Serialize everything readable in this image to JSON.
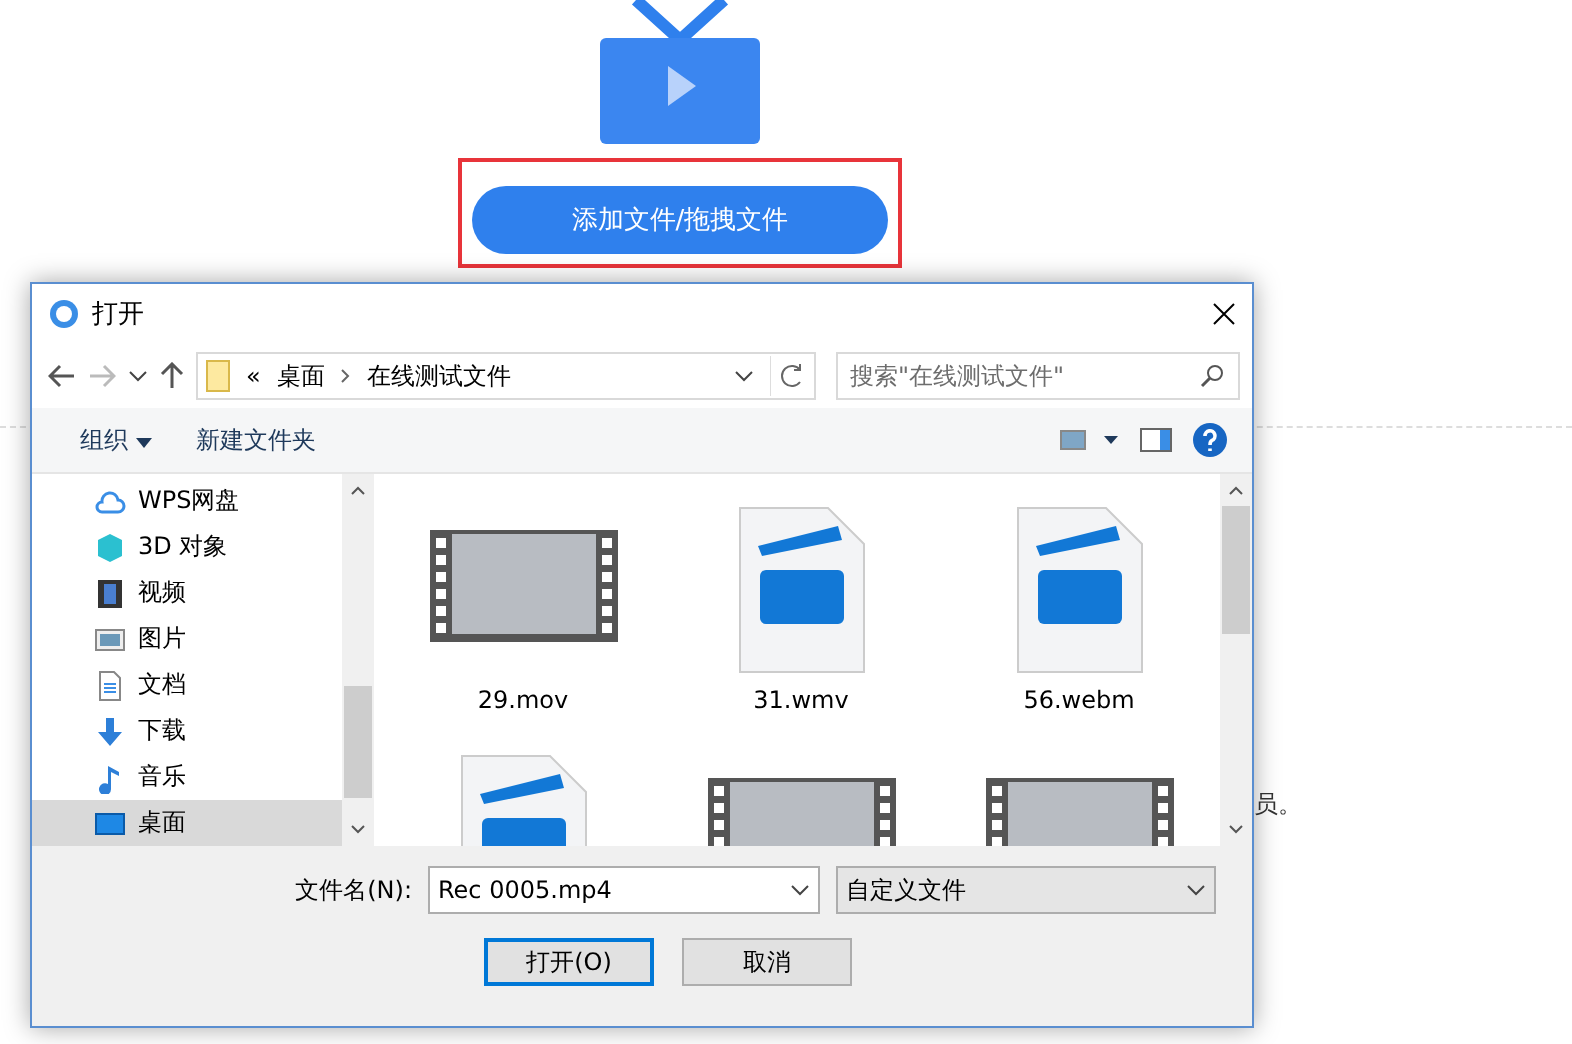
{
  "page": {
    "upload_button": "添加文件/拖拽文件",
    "trailing_text": "员。"
  },
  "dialog": {
    "title": "打开",
    "breadcrumb": {
      "prefix": "«",
      "parts": [
        "桌面",
        "在线测试文件"
      ]
    },
    "search": {
      "placeholder": "搜索\"在线测试文件\""
    },
    "toolbar": {
      "organize": "组织",
      "new_folder": "新建文件夹"
    },
    "sidebar": [
      {
        "kind": "cloud",
        "label": "WPS网盘",
        "selected": false
      },
      {
        "kind": "cube",
        "label": "3D 对象",
        "selected": false
      },
      {
        "kind": "film",
        "label": "视频",
        "selected": false
      },
      {
        "kind": "picture",
        "label": "图片",
        "selected": false
      },
      {
        "kind": "doc",
        "label": "文档",
        "selected": false
      },
      {
        "kind": "download",
        "label": "下载",
        "selected": false
      },
      {
        "kind": "music",
        "label": "音乐",
        "selected": false
      },
      {
        "kind": "desktop",
        "label": "桌面",
        "selected": true
      }
    ],
    "files": [
      {
        "kind": "video",
        "name": "29.mov"
      },
      {
        "kind": "clip",
        "name": "31.wmv"
      },
      {
        "kind": "clip",
        "name": "56.webm"
      },
      {
        "kind": "clip"
      },
      {
        "kind": "video"
      },
      {
        "kind": "video"
      }
    ],
    "filename_label": "文件名(N):",
    "filename": "Rec 0005.mp4",
    "filetype": "自定义文件",
    "buttons": {
      "open": "打开(O)",
      "cancel": "取消"
    }
  }
}
